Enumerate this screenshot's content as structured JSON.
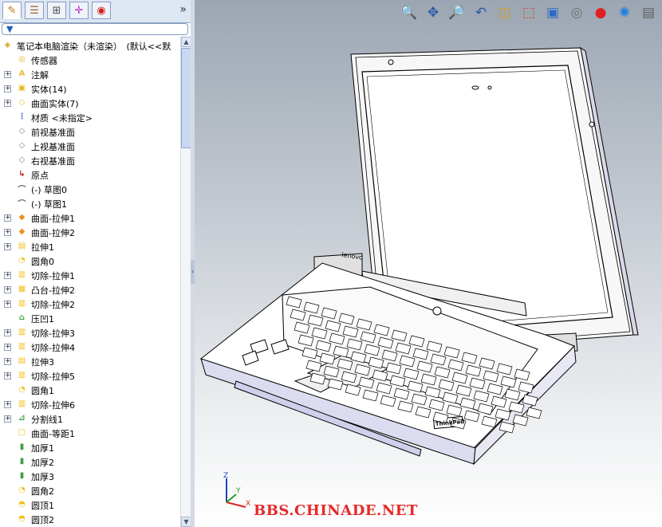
{
  "feature_manager": {
    "tabs": [
      {
        "icon": "feature-tree-icon"
      },
      {
        "icon": "property-manager-icon"
      },
      {
        "icon": "configuration-manager-icon"
      },
      {
        "icon": "dimxpert-icon"
      },
      {
        "icon": "appearance-icon"
      }
    ],
    "more_glyph": "»",
    "filter_glyph": "▼",
    "tree": [
      {
        "label": "笔记本电脑渲染（未渲染）　(默认<<默",
        "expand": false,
        "indent": 0,
        "icon": "part-icon",
        "color": "#d8a020"
      },
      {
        "label": "传感器",
        "expand": false,
        "indent": 1,
        "icon": "sensor-icon",
        "color": "#e0b020"
      },
      {
        "label": "注解",
        "expand": true,
        "indent": 1,
        "icon": "annotation-icon",
        "color": "#e8c040"
      },
      {
        "label": "实体(14)",
        "expand": true,
        "indent": 1,
        "icon": "solid-bodies-icon",
        "color": "#e8b820"
      },
      {
        "label": "曲面实体(7)",
        "expand": true,
        "indent": 1,
        "icon": "surface-bodies-icon",
        "color": "#e8b820"
      },
      {
        "label": "材质 <未指定>",
        "expand": false,
        "indent": 1,
        "icon": "material-icon",
        "color": "#4060c0"
      },
      {
        "label": "前视基准面",
        "expand": false,
        "indent": 1,
        "icon": "plane-icon",
        "color": "#808080"
      },
      {
        "label": "上视基准面",
        "expand": false,
        "indent": 1,
        "icon": "plane-icon",
        "color": "#808080"
      },
      {
        "label": "右视基准面",
        "expand": false,
        "indent": 1,
        "icon": "plane-icon",
        "color": "#808080"
      },
      {
        "label": "原点",
        "expand": false,
        "indent": 1,
        "icon": "origin-icon",
        "color": "#c02020"
      },
      {
        "label": "(-) 草图0",
        "expand": false,
        "indent": 1,
        "icon": "sketch-icon",
        "color": "#606060"
      },
      {
        "label": "(-) 草图1",
        "expand": false,
        "indent": 1,
        "icon": "sketch-icon",
        "color": "#606060"
      },
      {
        "label": "曲面-拉伸1",
        "expand": true,
        "indent": 1,
        "icon": "surface-extrude-icon",
        "color": "#e89020"
      },
      {
        "label": "曲面-拉伸2",
        "expand": true,
        "indent": 1,
        "icon": "surface-extrude-icon",
        "color": "#e89020"
      },
      {
        "label": "拉伸1",
        "expand": true,
        "indent": 1,
        "icon": "extrude-icon",
        "color": "#f0c020"
      },
      {
        "label": "圆角0",
        "expand": false,
        "indent": 1,
        "icon": "fillet-icon",
        "color": "#f0c020"
      },
      {
        "label": "切除-拉伸1",
        "expand": true,
        "indent": 1,
        "icon": "cut-extrude-icon",
        "color": "#f0c020"
      },
      {
        "label": "凸台-拉伸2",
        "expand": true,
        "indent": 1,
        "icon": "boss-extrude-icon",
        "color": "#f0c020"
      },
      {
        "label": "切除-拉伸2",
        "expand": true,
        "indent": 1,
        "icon": "cut-extrude-icon",
        "color": "#f0c020"
      },
      {
        "label": "压凹1",
        "expand": false,
        "indent": 1,
        "icon": "indent-icon",
        "color": "#40a040"
      },
      {
        "label": "切除-拉伸3",
        "expand": true,
        "indent": 1,
        "icon": "cut-extrude-icon",
        "color": "#f0c020"
      },
      {
        "label": "切除-拉伸4",
        "expand": true,
        "indent": 1,
        "icon": "cut-extrude-icon",
        "color": "#f0c020"
      },
      {
        "label": "拉伸3",
        "expand": true,
        "indent": 1,
        "icon": "extrude-icon",
        "color": "#f0c020"
      },
      {
        "label": "切除-拉伸5",
        "expand": true,
        "indent": 1,
        "icon": "cut-extrude-icon",
        "color": "#f0c020"
      },
      {
        "label": "圆角1",
        "expand": false,
        "indent": 1,
        "icon": "fillet-icon",
        "color": "#f0c020"
      },
      {
        "label": "切除-拉伸6",
        "expand": true,
        "indent": 1,
        "icon": "cut-extrude-icon",
        "color": "#f0c020"
      },
      {
        "label": "分割线1",
        "expand": true,
        "indent": 1,
        "icon": "split-line-icon",
        "color": "#40a040"
      },
      {
        "label": "曲面-等距1",
        "expand": false,
        "indent": 1,
        "icon": "surface-offset-icon",
        "color": "#f0c020"
      },
      {
        "label": "加厚1",
        "expand": false,
        "indent": 1,
        "icon": "thicken-icon",
        "color": "#40a040"
      },
      {
        "label": "加厚2",
        "expand": false,
        "indent": 1,
        "icon": "thicken-icon",
        "color": "#40a040"
      },
      {
        "label": "加厚3",
        "expand": false,
        "indent": 1,
        "icon": "thicken-icon",
        "color": "#40a040"
      },
      {
        "label": "圆角2",
        "expand": false,
        "indent": 1,
        "icon": "fillet-icon",
        "color": "#f0c020"
      },
      {
        "label": "圆顶1",
        "expand": false,
        "indent": 1,
        "icon": "dome-icon",
        "color": "#f0c020"
      },
      {
        "label": "圆顶2",
        "expand": false,
        "indent": 1,
        "icon": "dome-icon",
        "color": "#f0c020"
      }
    ]
  },
  "view_toolbar": [
    {
      "icon": "zoom-to-fit-icon",
      "glyph": "🔍"
    },
    {
      "icon": "pan-icon",
      "glyph": "✥"
    },
    {
      "icon": "zoom-to-area-icon",
      "glyph": "🔎"
    },
    {
      "icon": "previous-view-icon",
      "glyph": "↶"
    },
    {
      "icon": "section-view-icon",
      "glyph": "◫"
    },
    {
      "icon": "view-orientation-icon",
      "glyph": "⬚"
    },
    {
      "icon": "display-style-icon",
      "glyph": "▣"
    },
    {
      "icon": "hide-show-items-icon",
      "glyph": "◎"
    },
    {
      "icon": "edit-appearance-icon",
      "glyph": "●"
    },
    {
      "icon": "apply-scene-icon",
      "glyph": "✺"
    },
    {
      "icon": "view-settings-icon",
      "glyph": "▤"
    }
  ],
  "model": {
    "brand_lid": "lenovo",
    "brand_badge": "ThinkPad"
  },
  "watermark": "BBS.CHINADE.NET",
  "triad": {
    "x": "X",
    "y": "Y",
    "z": "Z"
  }
}
